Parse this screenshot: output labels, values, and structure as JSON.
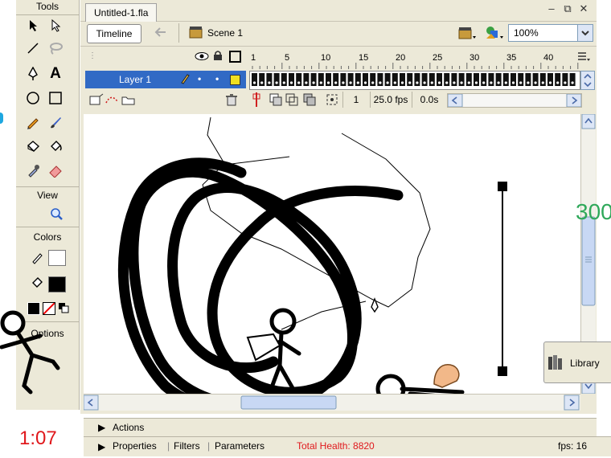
{
  "tools_panel": {
    "title": "Tools",
    "view_label": "View",
    "colors_label": "Colors",
    "options_label": "Options"
  },
  "document": {
    "tab_title": "Untitled-1.fla",
    "controls": [
      "–",
      "⧉",
      "✕"
    ]
  },
  "nav": {
    "timeline_label": "Timeline",
    "scene_label": "Scene 1",
    "zoom_value": "100%"
  },
  "timeline": {
    "frame_numbers": [
      "1",
      "5",
      "10",
      "15",
      "20",
      "25",
      "30",
      "35",
      "40"
    ],
    "layer_name": "Layer 1",
    "current_frame": "1",
    "fps": "25.0 fps",
    "elapsed": "0.0s"
  },
  "panels": {
    "actions": "Actions",
    "properties": "Properties",
    "filters": "Filters",
    "parameters": "Parameters",
    "library": "Library"
  },
  "game_overlay": {
    "timer": "1:07",
    "total_health": "Total Health: 8820",
    "fps_counter": "fps: 16",
    "score_fragment": "300"
  },
  "colors": {
    "panel_bg": "#ece9d8",
    "layer_highlight": "#316ac5",
    "timer_red": "#e0181c",
    "health_red": "#e0181c",
    "score_green": "#2fa85a"
  }
}
